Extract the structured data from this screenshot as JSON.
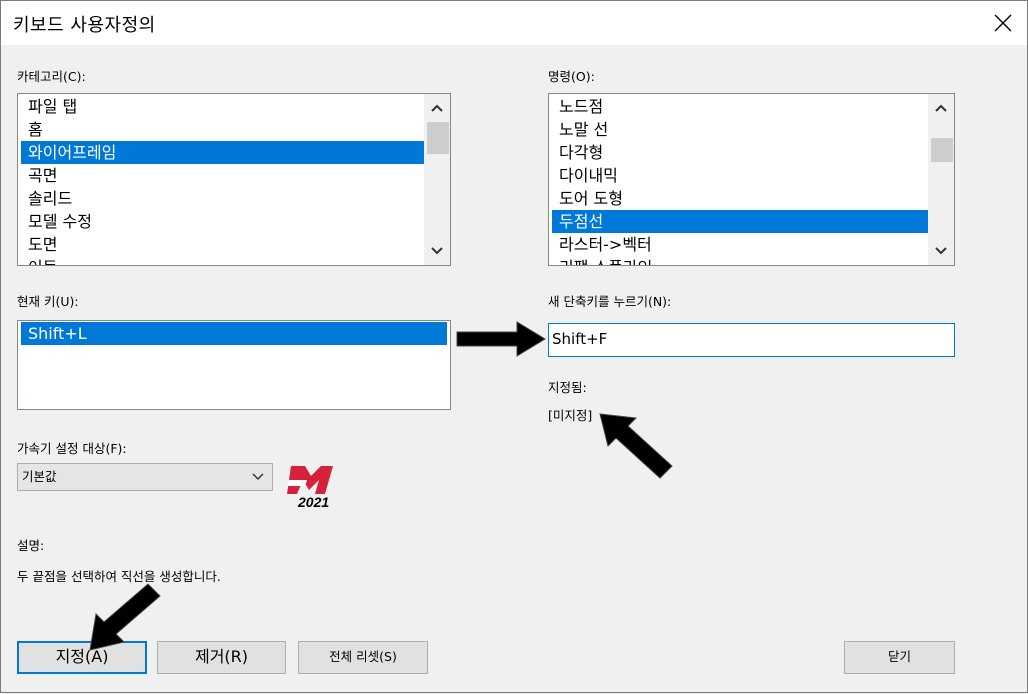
{
  "window": {
    "title": "키보드 사용자정의"
  },
  "category": {
    "label": "카테고리(C):",
    "items": [
      "파일 탭",
      "홈",
      "와이어프레임",
      "곡면",
      "솔리드",
      "모델 수정",
      "도면",
      "이동"
    ],
    "selected_index": 2
  },
  "command": {
    "label": "명령(O):",
    "items": [
      "노드점",
      "노말 선",
      "다각형",
      "다이내믹",
      "도어 도형",
      "두점선",
      "라스터->벡터",
      "리팩 스플라인"
    ],
    "selected_index": 5
  },
  "current_key": {
    "label": "현재 키(U):",
    "items": [
      "Shift+L"
    ]
  },
  "new_shortcut": {
    "label": "새 단축키를 누르기(N):",
    "value": "Shift+F"
  },
  "assigned": {
    "label": "지정됨:",
    "value": "[미지정]"
  },
  "accelerator": {
    "label": "가속기 설정 대상(F):",
    "value": "기본값"
  },
  "logo": {
    "year": "2021",
    "color": "#d6213b"
  },
  "description": {
    "label": "설명:",
    "text": "두 끝점을 선택하여 직선을 생성합니다."
  },
  "buttons": {
    "assign": "지정(A)",
    "remove": "제거(R)",
    "reset_all": "전체 리셋(S)",
    "close": "닫기"
  },
  "colors": {
    "selection": "#0078d7",
    "annotation_arrow": "#000000"
  }
}
